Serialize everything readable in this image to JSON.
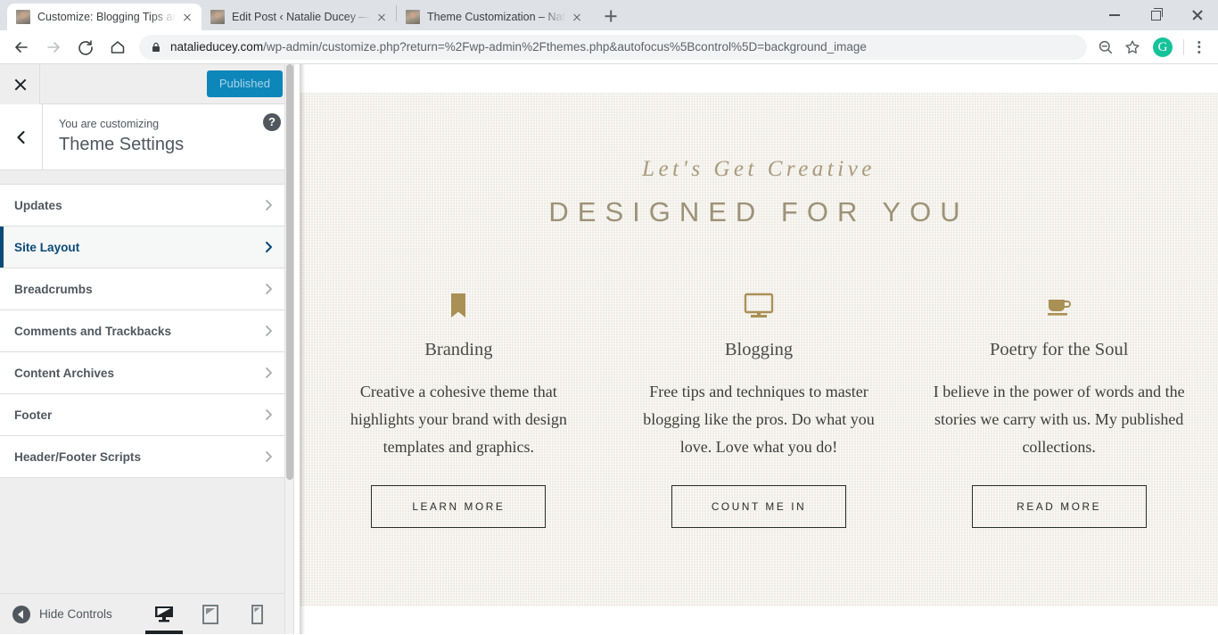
{
  "browser": {
    "tabs": [
      {
        "title": "Customize: Blogging Tips and Br",
        "active": true
      },
      {
        "title": "Edit Post ‹ Natalie Ducey — Word",
        "active": false
      },
      {
        "title": "Theme Customization – Natalie",
        "active": false
      }
    ],
    "new_tab_label": "+",
    "nav": {
      "back": "back-arrow",
      "forward": "forward-arrow",
      "reload": "reload-icon",
      "home": "home-icon"
    },
    "omnibox": {
      "lock_icon": "lock-icon",
      "url_domain": "natalieducey.com",
      "url_path": "/wp-admin/customize.php?return=%2Fwp-admin%2Fthemes.php&autofocus%5Bcontrol%5D=background_image"
    },
    "actions": {
      "zoom_label": "zoom-out-icon",
      "bookmark_label": "star-icon",
      "extension_label": "G",
      "menu_label": "kebab-menu-icon"
    },
    "window_controls": {
      "minimize": "minimize-icon",
      "maximize": "maximize-icon",
      "close": "close-icon"
    }
  },
  "customizer": {
    "close_label": "close-icon",
    "publish_label": "Published",
    "eyebrow": "You are customizing",
    "panel_title": "Theme Settings",
    "help_label": "?",
    "back_label": "back-chevron-icon",
    "items": [
      {
        "label": "Updates",
        "active": false
      },
      {
        "label": "Site Layout",
        "active": true
      },
      {
        "label": "Breadcrumbs",
        "active": false
      },
      {
        "label": "Comments and Trackbacks",
        "active": false
      },
      {
        "label": "Content Archives",
        "active": false
      },
      {
        "label": "Footer",
        "active": false
      },
      {
        "label": "Header/Footer Scripts",
        "active": false
      }
    ],
    "footer": {
      "hide_controls_label": "Hide Controls",
      "devices": [
        {
          "name": "desktop",
          "active": true
        },
        {
          "name": "tablet",
          "active": false
        },
        {
          "name": "mobile",
          "active": false
        }
      ]
    },
    "accent_color": "#0a4b78",
    "publish_color": "#0d86ba"
  },
  "preview": {
    "eyebrow": "Let's Get Creative",
    "headline": "DESIGNED FOR YOU",
    "columns": [
      {
        "icon": "bookmark-icon",
        "title": "Branding",
        "text": "Creative a cohesive theme that highlights your brand with design templates and graphics.",
        "button": "LEARN MORE"
      },
      {
        "icon": "desktop-monitor-icon",
        "title": "Blogging",
        "text": "Free tips and techniques to master blogging like the pros. Do what you love. Love what you do!",
        "button": "COUNT ME IN"
      },
      {
        "icon": "coffee-cup-icon",
        "title": "Poetry for the Soul",
        "text": "I believe in the power of words and the stories we carry with us. My published collections.",
        "button": "READ MORE"
      }
    ],
    "background_color": "#f4f1ea",
    "accent_color": "#a99055"
  }
}
